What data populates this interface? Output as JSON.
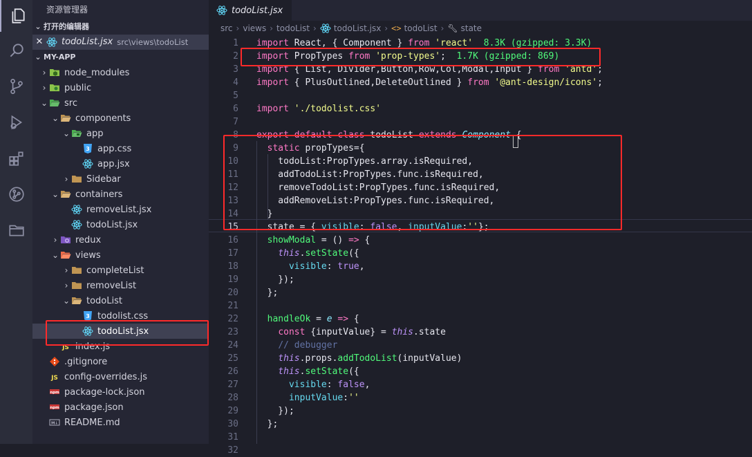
{
  "explorer": {
    "title": "资源管理器",
    "open_editors_label": "打开的编辑器",
    "open_file": {
      "name": "todoList.jsx",
      "path": "src\\views\\todoList"
    },
    "project_label": "MY-APP",
    "tree": [
      {
        "label": "node_modules",
        "depth": 0,
        "type": "folder-node",
        "arrow": "›"
      },
      {
        "label": "public",
        "depth": 0,
        "type": "folder-public",
        "arrow": "›"
      },
      {
        "label": "src",
        "depth": 0,
        "type": "folder-src",
        "arrow": "⌄"
      },
      {
        "label": "components",
        "depth": 1,
        "type": "folder-open",
        "arrow": "⌄"
      },
      {
        "label": "app",
        "depth": 2,
        "type": "folder-app",
        "arrow": "⌄"
      },
      {
        "label": "app.css",
        "depth": 3,
        "type": "css",
        "arrow": ""
      },
      {
        "label": "app.jsx",
        "depth": 3,
        "type": "react",
        "arrow": ""
      },
      {
        "label": "Sidebar",
        "depth": 2,
        "type": "folder",
        "arrow": "›"
      },
      {
        "label": "containers",
        "depth": 1,
        "type": "folder-open",
        "arrow": "⌄"
      },
      {
        "label": "removeList.jsx",
        "depth": 2,
        "type": "react",
        "arrow": ""
      },
      {
        "label": "todoList.jsx",
        "depth": 2,
        "type": "react",
        "arrow": ""
      },
      {
        "label": "redux",
        "depth": 1,
        "type": "folder-redux",
        "arrow": "›"
      },
      {
        "label": "views",
        "depth": 1,
        "type": "folder-views",
        "arrow": "⌄"
      },
      {
        "label": "completeList",
        "depth": 2,
        "type": "folder",
        "arrow": "›"
      },
      {
        "label": "removeList",
        "depth": 2,
        "type": "folder",
        "arrow": "›"
      },
      {
        "label": "todoList",
        "depth": 2,
        "type": "folder-open",
        "arrow": "⌄"
      },
      {
        "label": "todolist.css",
        "depth": 3,
        "type": "css",
        "arrow": ""
      },
      {
        "label": "todoList.jsx",
        "depth": 3,
        "type": "react",
        "arrow": "",
        "selected": true
      },
      {
        "label": "index.js",
        "depth": 1,
        "type": "js",
        "arrow": ""
      },
      {
        "label": ".gitignore",
        "depth": 0,
        "type": "git",
        "arrow": ""
      },
      {
        "label": "config-overrides.js",
        "depth": 0,
        "type": "js",
        "arrow": ""
      },
      {
        "label": "package-lock.json",
        "depth": 0,
        "type": "npm",
        "arrow": ""
      },
      {
        "label": "package.json",
        "depth": 0,
        "type": "npm",
        "arrow": ""
      },
      {
        "label": "README.md",
        "depth": 0,
        "type": "md",
        "arrow": ""
      }
    ]
  },
  "tab": {
    "label": "todoList.jsx"
  },
  "breadcrumb": [
    "src",
    "views",
    "todoList",
    "todoList.jsx",
    "todoList",
    "state"
  ],
  "editor": {
    "lines": [
      [
        [
          "kw",
          "import"
        ],
        [
          "t",
          " React, { Component } "
        ],
        [
          "kw",
          "from"
        ],
        [
          "t",
          " "
        ],
        [
          "str",
          "'react'"
        ],
        [
          "t",
          "  "
        ],
        [
          "size",
          "8.3K (gzipped: 3.3K)"
        ]
      ],
      [
        [
          "kw",
          "import"
        ],
        [
          "t",
          " PropTypes "
        ],
        [
          "kw",
          "from"
        ],
        [
          "t",
          " "
        ],
        [
          "str",
          "'prop-types'"
        ],
        [
          "t",
          ";  "
        ],
        [
          "size",
          "1.7K (gzipped: 869)"
        ]
      ],
      [
        [
          "kw",
          "import"
        ],
        [
          "t",
          " { List, Divider,Button,Row,Col,Modal,Input } "
        ],
        [
          "kw",
          "from"
        ],
        [
          "t",
          " "
        ],
        [
          "str",
          "'antd'"
        ],
        [
          "t",
          ";"
        ]
      ],
      [
        [
          "kw",
          "import"
        ],
        [
          "t",
          " { PlusOutlined,DeleteOutlined } "
        ],
        [
          "kw",
          "from"
        ],
        [
          "t",
          " "
        ],
        [
          "str",
          "'@ant-design/icons'"
        ],
        [
          "t",
          ";"
        ]
      ],
      [],
      [
        [
          "kw",
          "import"
        ],
        [
          "t",
          " "
        ],
        [
          "str",
          "'./todolist.css'"
        ]
      ],
      [],
      [
        [
          "kw",
          "export"
        ],
        [
          "t",
          " "
        ],
        [
          "kw",
          "default"
        ],
        [
          "t",
          " "
        ],
        [
          "kw",
          "class"
        ],
        [
          "t",
          " todoList "
        ],
        [
          "kw",
          "extends"
        ],
        [
          "t",
          " "
        ],
        [
          "cls",
          "Component"
        ],
        [
          "t",
          " {"
        ]
      ],
      [
        [
          "t",
          "  "
        ],
        [
          "kw",
          "static"
        ],
        [
          "t",
          " propTypes={"
        ]
      ],
      [
        [
          "t",
          "    todoList:PropTypes.array.isRequired,"
        ]
      ],
      [
        [
          "t",
          "    addTodoList:PropTypes.func.isRequired,"
        ]
      ],
      [
        [
          "t",
          "    removeTodoList:PropTypes.func.isRequired,"
        ]
      ],
      [
        [
          "t",
          "    addRemoveList:PropTypes.func.isRequired,"
        ]
      ],
      [
        [
          "t",
          "  }"
        ]
      ],
      [
        [
          "t",
          "  state = { "
        ],
        [
          "attr",
          "visible"
        ],
        [
          "t",
          ": "
        ],
        [
          "num",
          "false"
        ],
        [
          "t",
          ", "
        ],
        [
          "attr",
          "inputValue"
        ],
        [
          "t",
          ":"
        ],
        [
          "str",
          "''"
        ],
        [
          "t",
          "};"
        ]
      ],
      [
        [
          "t",
          "  "
        ],
        [
          "fn",
          "showModal"
        ],
        [
          "t",
          " = () "
        ],
        [
          "kw",
          "=>"
        ],
        [
          "t",
          " {"
        ]
      ],
      [
        [
          "t",
          "    "
        ],
        [
          "thisk",
          "this"
        ],
        [
          "t",
          "."
        ],
        [
          "fn",
          "setState"
        ],
        [
          "t",
          "({"
        ]
      ],
      [
        [
          "t",
          "      "
        ],
        [
          "attr",
          "visible"
        ],
        [
          "t",
          ": "
        ],
        [
          "num",
          "true"
        ],
        [
          "t",
          ","
        ]
      ],
      [
        [
          "t",
          "    });"
        ]
      ],
      [
        [
          "t",
          "  };"
        ]
      ],
      [],
      [
        [
          "t",
          "  "
        ],
        [
          "fn",
          "handleOk"
        ],
        [
          "t",
          " = "
        ],
        [
          "cls",
          "e"
        ],
        [
          "t",
          " "
        ],
        [
          "kw",
          "=>"
        ],
        [
          "t",
          " {"
        ]
      ],
      [
        [
          "t",
          "    "
        ],
        [
          "kw",
          "const"
        ],
        [
          "t",
          " {inputValue} = "
        ],
        [
          "thisk",
          "this"
        ],
        [
          "t",
          ".state"
        ]
      ],
      [
        [
          "t",
          "    "
        ],
        [
          "cmt",
          "// debugger"
        ]
      ],
      [
        [
          "t",
          "    "
        ],
        [
          "thisk",
          "this"
        ],
        [
          "t",
          ".props."
        ],
        [
          "fn",
          "addTodoList"
        ],
        [
          "t",
          "(inputValue)"
        ]
      ],
      [
        [
          "t",
          "    "
        ],
        [
          "thisk",
          "this"
        ],
        [
          "t",
          "."
        ],
        [
          "fn",
          "setState"
        ],
        [
          "t",
          "({"
        ]
      ],
      [
        [
          "t",
          "      "
        ],
        [
          "attr",
          "visible"
        ],
        [
          "t",
          ": "
        ],
        [
          "num",
          "false"
        ],
        [
          "t",
          ","
        ]
      ],
      [
        [
          "t",
          "      "
        ],
        [
          "attr",
          "inputValue"
        ],
        [
          "t",
          ":"
        ],
        [
          "str",
          "''"
        ]
      ],
      [
        [
          "t",
          "    });"
        ]
      ],
      [
        [
          "t",
          "  };"
        ]
      ],
      [],
      [
        [
          "t",
          ""
        ]
      ]
    ],
    "active_line": 15
  }
}
